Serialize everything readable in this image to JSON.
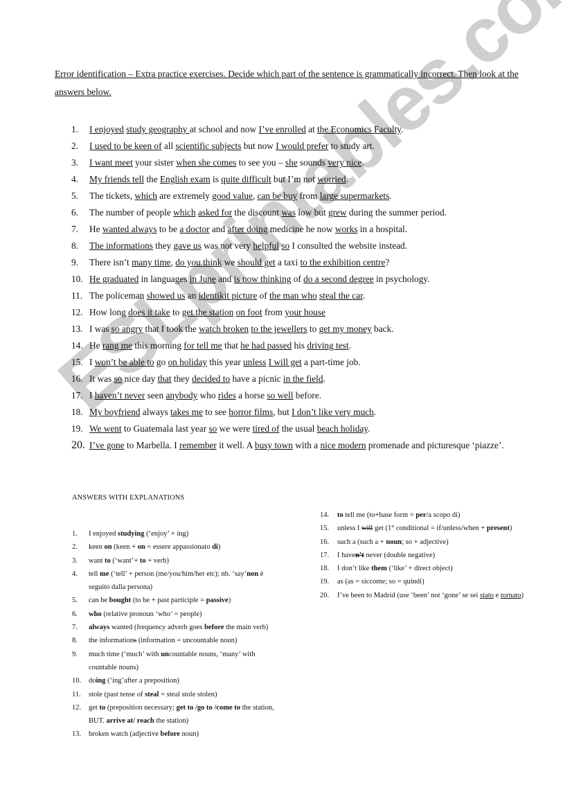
{
  "watermark": "ESLprintables.com",
  "intro": "Error identification – Extra practice exercises.  Decide which part of the sentence is grammatically incorrect. Then look at the answers below.",
  "questions": [
    {
      "num": "1.",
      "parts": [
        {
          "t": "I enjoyed",
          "u": true
        },
        {
          "t": "  "
        },
        {
          "t": "study geography ",
          "u": true
        },
        {
          "t": "at school and now "
        },
        {
          "t": "I’ve enrolled",
          "u": true
        },
        {
          "t": " at "
        },
        {
          "t": "the Economics Faculty",
          "u": true
        },
        {
          "t": "."
        }
      ]
    },
    {
      "num": "2.",
      "parts": [
        {
          "t": "I used to be ",
          "u": true
        },
        {
          "t": " "
        },
        {
          "t": "keen of",
          "u": true
        },
        {
          "t": " all "
        },
        {
          "t": "scientific subjects",
          "u": true
        },
        {
          "t": " but now "
        },
        {
          "t": "I would prefer",
          "u": true
        },
        {
          "t": " to study art."
        }
      ]
    },
    {
      "num": "3.",
      "parts": [
        {
          "t": "I want meet",
          "u": true
        },
        {
          "t": " your sister "
        },
        {
          "t": "when she comes",
          "u": true
        },
        {
          "t": " to see you – "
        },
        {
          "t": "she",
          "u": true
        },
        {
          "t": " sounds "
        },
        {
          "t": "very nice",
          "u": true
        },
        {
          "t": "."
        }
      ]
    },
    {
      "num": "4.",
      "parts": [
        {
          "t": "My friends tell",
          "u": true
        },
        {
          "t": " the "
        },
        {
          "t": "English exam",
          "u": true
        },
        {
          "t": " is "
        },
        {
          "t": "quite difficult",
          "u": true
        },
        {
          "t": " but I’m not "
        },
        {
          "t": "worried",
          "u": true
        },
        {
          "t": "."
        }
      ]
    },
    {
      "num": "5.",
      "parts": [
        {
          "t": "The tickets, "
        },
        {
          "t": "which",
          "u": true
        },
        {
          "t": " are extremely "
        },
        {
          "t": "good value",
          "u": true
        },
        {
          "t": ", "
        },
        {
          "t": "can be buy",
          "u": true
        },
        {
          "t": " from "
        },
        {
          "t": "large supermarkets",
          "u": true
        },
        {
          "t": "."
        }
      ]
    },
    {
      "num": "6.",
      "parts": [
        {
          "t": "The number of people "
        },
        {
          "t": "which",
          "u": true
        },
        {
          "t": " "
        },
        {
          "t": "asked for",
          "u": true
        },
        {
          "t": " the discount "
        },
        {
          "t": "was",
          "u": true
        },
        {
          "t": " low but "
        },
        {
          "t": "grew",
          "u": true
        },
        {
          "t": " during the summer period."
        }
      ]
    },
    {
      "num": "7.",
      "parts": [
        {
          "t": "He "
        },
        {
          "t": "wanted always",
          "u": true
        },
        {
          "t": " to be "
        },
        {
          "t": "a doctor",
          "u": true
        },
        {
          "t": " and "
        },
        {
          "t": "after doing",
          "u": true
        },
        {
          "t": " medicine he now "
        },
        {
          "t": "works",
          "u": true
        },
        {
          "t": " in a hospital."
        }
      ]
    },
    {
      "num": "8.",
      "parts": [
        {
          "t": "The informations",
          "u": true
        },
        {
          "t": " they "
        },
        {
          "t": "gave us",
          "u": true
        },
        {
          "t": " was not very "
        },
        {
          "t": "helpful",
          "u": true
        },
        {
          "t": " "
        },
        {
          "t": "so",
          "u": true
        },
        {
          "t": " I consulted the website instead."
        }
      ]
    },
    {
      "num": "9.",
      "parts": [
        {
          "t": "There isn’t "
        },
        {
          "t": "many time",
          "u": true
        },
        {
          "t": ", "
        },
        {
          "t": "do you think",
          "u": true
        },
        {
          "t": " we "
        },
        {
          "t": "should get",
          "u": true
        },
        {
          "t": " a taxi "
        },
        {
          "t": "to the exhibition centre",
          "u": true
        },
        {
          "t": "?"
        }
      ]
    },
    {
      "num": "10.",
      "parts": [
        {
          "t": "He graduated",
          "u": true
        },
        {
          "t": " in languages "
        },
        {
          "t": "in June",
          "u": true
        },
        {
          "t": " and "
        },
        {
          "t": "is now thinking",
          "u": true
        },
        {
          "t": " of "
        },
        {
          "t": "do a second degree",
          "u": true
        },
        {
          "t": " in psychology."
        }
      ]
    },
    {
      "num": "11.",
      "parts": [
        {
          "t": "The policeman "
        },
        {
          "t": "showed us",
          "u": true
        },
        {
          "t": " an "
        },
        {
          "t": "identikit picture",
          "u": true
        },
        {
          "t": " of "
        },
        {
          "t": "the man who",
          "u": true
        },
        {
          "t": " "
        },
        {
          "t": "steal the car",
          "u": true
        },
        {
          "t": "."
        }
      ]
    },
    {
      "num": "12.",
      "parts": [
        {
          "t": "How long "
        },
        {
          "t": "does it take",
          "u": true
        },
        {
          "t": " to "
        },
        {
          "t": "get the station",
          "u": true
        },
        {
          "t": " "
        },
        {
          "t": "on foot",
          "u": true
        },
        {
          "t": " from "
        },
        {
          "t": "your house",
          "u": true
        }
      ]
    },
    {
      "num": "13.",
      "parts": [
        {
          "t": "I was "
        },
        {
          "t": "so angry",
          "u": true
        },
        {
          "t": " that I took the "
        },
        {
          "t": "watch broken",
          "u": true
        },
        {
          "t": " "
        },
        {
          "t": "to the jewellers",
          "u": true
        },
        {
          "t": " to "
        },
        {
          "t": "get my money",
          "u": true
        },
        {
          "t": " back."
        }
      ]
    },
    {
      "num": "14.",
      "parts": [
        {
          "t": "He "
        },
        {
          "t": "rang me",
          "u": true
        },
        {
          "t": " this morning "
        },
        {
          "t": "for tell me",
          "u": true
        },
        {
          "t": " that "
        },
        {
          "t": "he had passed",
          "u": true
        },
        {
          "t": " his "
        },
        {
          "t": "driving test",
          "u": true
        },
        {
          "t": "."
        }
      ]
    },
    {
      "num": "15.",
      "parts": [
        {
          "t": "I "
        },
        {
          "t": "won’t be able to",
          "u": true
        },
        {
          "t": " go "
        },
        {
          "t": "on holiday",
          "u": true
        },
        {
          "t": " this year "
        },
        {
          "t": "unless",
          "u": true
        },
        {
          "t": " "
        },
        {
          "t": "I will get",
          "u": true
        },
        {
          "t": " a part-time job."
        }
      ]
    },
    {
      "num": "16.",
      "parts": [
        {
          "t": "It was "
        },
        {
          "t": "so",
          "u": true
        },
        {
          "t": " nice day "
        },
        {
          "t": "that",
          "u": true
        },
        {
          "t": " they "
        },
        {
          "t": "decided to",
          "u": true
        },
        {
          "t": " have a picnic "
        },
        {
          "t": "in the field",
          "u": true
        },
        {
          "t": "."
        }
      ]
    },
    {
      "num": "17.",
      "parts": [
        {
          "t": "I "
        },
        {
          "t": "haven’t never",
          "u": true
        },
        {
          "t": " seen "
        },
        {
          "t": "anybody",
          "u": true
        },
        {
          "t": " who "
        },
        {
          "t": "rides",
          "u": true
        },
        {
          "t": " a horse "
        },
        {
          "t": "so well",
          "u": true
        },
        {
          "t": " before."
        }
      ]
    },
    {
      "num": "18.",
      "parts": [
        {
          "t": "My boyfriend",
          "u": true
        },
        {
          "t": " always "
        },
        {
          "t": "takes me",
          "u": true
        },
        {
          "t": " to see "
        },
        {
          "t": "horror films",
          "u": true
        },
        {
          "t": ", but "
        },
        {
          "t": "I don’t like very much",
          "u": true
        },
        {
          "t": "."
        }
      ]
    },
    {
      "num": "19.",
      "parts": [
        {
          "t": "We went",
          "u": true
        },
        {
          "t": " to Guatemala last year "
        },
        {
          "t": "so",
          "u": true
        },
        {
          "t": " we were "
        },
        {
          "t": "tired of",
          "u": true
        },
        {
          "t": " the usual "
        },
        {
          "t": "beach holiday",
          "u": true
        },
        {
          "t": "."
        }
      ]
    },
    {
      "num": "20.",
      "parts": [
        {
          "t": "I’ve gone",
          "u": true
        },
        {
          "t": " to Marbella.  I "
        },
        {
          "t": "remember",
          "u": true
        },
        {
          "t": " it well.  A "
        },
        {
          "t": "busy town",
          "u": true
        },
        {
          "t": " with a "
        },
        {
          "t": "nice modern",
          "u": true
        },
        {
          "t": " promenade and picturesque ‘piazze’."
        }
      ]
    }
  ],
  "answers_title": "ANSWERS WITH EXPLANATIONS",
  "answers_left": [
    {
      "num": "1.",
      "parts": [
        {
          "t": "I enjoyed "
        },
        {
          "t": "studying",
          "b": true
        },
        {
          "t": " (‘enjoy’  + ing)"
        }
      ]
    },
    {
      "num": "2.",
      "parts": [
        {
          "t": "keen "
        },
        {
          "t": "on",
          "b": true
        },
        {
          "t": " (keen + "
        },
        {
          "t": "on",
          "b": true
        },
        {
          "t": " = essere appassionato "
        },
        {
          "t": "di",
          "b": true
        },
        {
          "t": ")"
        }
      ]
    },
    {
      "num": "3.",
      "parts": [
        {
          "t": "want "
        },
        {
          "t": "to",
          "b": true
        },
        {
          "t": " (‘want’+ "
        },
        {
          "t": "to",
          "b": true
        },
        {
          "t": " + verb)"
        }
      ]
    },
    {
      "num": "4.",
      "parts": [
        {
          "t": "tell "
        },
        {
          "t": "me",
          "b": true
        },
        {
          "t": " (‘tell’ + person (me/you/him/her etc); nb. ‘say’"
        },
        {
          "t": "non",
          "b": true
        },
        {
          "t": " è seguito dalla persona)"
        }
      ]
    },
    {
      "num": "5.",
      "parts": [
        {
          "t": "can be "
        },
        {
          "t": "bought",
          "b": true
        },
        {
          "t": " (to be + past participle = "
        },
        {
          "t": "passive",
          "b": true
        },
        {
          "t": ")"
        }
      ]
    },
    {
      "num": "6.",
      "parts": [
        {
          "t": "who",
          "b": true
        },
        {
          "t": " (relative pronoun ‘who’ = people)"
        }
      ]
    },
    {
      "num": "7.",
      "parts": [
        {
          "t": "always",
          "b": true
        },
        {
          "t": " wanted (frequency adverb goes "
        },
        {
          "t": "before",
          "b": true
        },
        {
          "t": " the main verb)"
        }
      ]
    },
    {
      "num": "8.",
      "parts": [
        {
          "t": "the information"
        },
        {
          "t": "s",
          "s": true
        },
        {
          "t": " (information = uncountable noun)"
        }
      ]
    },
    {
      "num": "9.",
      "parts": [
        {
          "t": "much time (‘much’ with "
        },
        {
          "t": "un",
          "b": true
        },
        {
          "t": "countable nouns, ‘many’ with countable nouns)"
        }
      ]
    },
    {
      "num": "10.",
      "parts": [
        {
          "t": "do"
        },
        {
          "t": "ing",
          "b": true
        },
        {
          "t": " (‘ing’after a preposition)"
        }
      ]
    },
    {
      "num": "11.",
      "parts": [
        {
          "t": "stole (past tense of "
        },
        {
          "t": "steal",
          "b": true
        },
        {
          "t": " = steal stole stolen)"
        }
      ]
    },
    {
      "num": "12.",
      "parts": [
        {
          "t": "get "
        },
        {
          "t": "to",
          "b": true
        },
        {
          "t": " (preposition necessary; "
        },
        {
          "t": "get to /go to /come to",
          "b": true
        },
        {
          "t": " the station, BUT. "
        },
        {
          "t": "arrive at/ reach",
          "b": true
        },
        {
          "t": " the station)"
        }
      ]
    },
    {
      "num": "13.",
      "parts": [
        {
          "t": "broken watch (adjective "
        },
        {
          "t": "before",
          "b": true
        },
        {
          "t": " noun)"
        }
      ]
    }
  ],
  "answers_right": [
    {
      "num": "14.",
      "parts": [
        {
          "t": "to",
          "b": true
        },
        {
          "t": " tell me (to+base form = "
        },
        {
          "t": "per",
          "b": true
        },
        {
          "t": "/a scopo di)"
        }
      ]
    },
    {
      "num": "15.",
      "parts": [
        {
          "t": "unless I "
        },
        {
          "t": "will",
          "s": true
        },
        {
          "t": " get (1° conditional = if/unless/when + "
        },
        {
          "t": "present",
          "b": true
        },
        {
          "t": ")"
        }
      ]
    },
    {
      "num": "16.",
      "parts": [
        {
          "t": "such a (such a + "
        },
        {
          "t": "noun",
          "b": true
        },
        {
          "t": "; so + adjective)"
        }
      ]
    },
    {
      "num": "17.",
      "parts": [
        {
          "t": "I have"
        },
        {
          "t": "n’t",
          "s": true,
          "b": true
        },
        {
          "t": " never (double negative)"
        }
      ]
    },
    {
      "num": "18.",
      "parts": [
        {
          "t": "I don’t like "
        },
        {
          "t": "them",
          "b": true
        },
        {
          "t": " (‘like’ + direct object)"
        }
      ]
    },
    {
      "num": "19.",
      "parts": [
        {
          "t": "as (as = siccome; so = quindi)"
        }
      ]
    },
    {
      "num": "20.",
      "parts": [
        {
          "t": "I’ve been to Madrid (use ‘been’ not ‘gone’ se sei "
        },
        {
          "t": "stato",
          "u": true
        },
        {
          "t": " e "
        },
        {
          "t": "tornato",
          "u": true
        },
        {
          "t": ")"
        }
      ]
    }
  ]
}
